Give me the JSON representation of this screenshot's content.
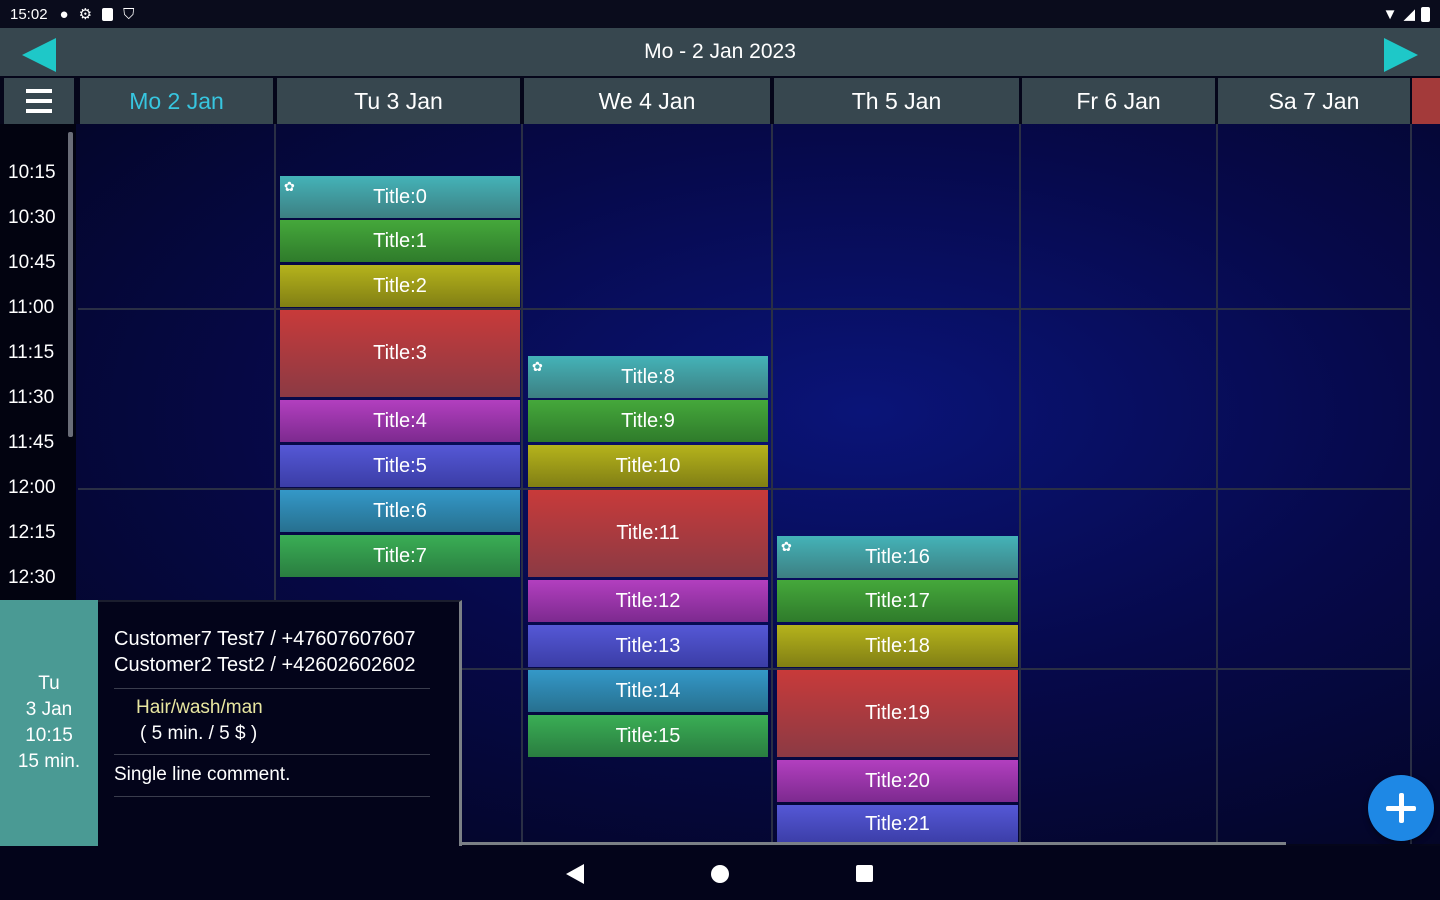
{
  "status_bar": {
    "time": "15:02"
  },
  "nav": {
    "title": "Mo - 2 Jan 2023"
  },
  "days": [
    {
      "label": "Mo   2 Jan",
      "today": true
    },
    {
      "label": "Tu   3 Jan"
    },
    {
      "label": "We   4 Jan"
    },
    {
      "label": "Th   5 Jan"
    },
    {
      "label": "Fr   6 Jan"
    },
    {
      "label": "Sa   7 Jan"
    }
  ],
  "times": [
    "10:15",
    "10:30",
    "10:45",
    "11:00",
    "11:15",
    "11:30",
    "11:45",
    "12:00",
    "12:15",
    "12:30"
  ],
  "events": {
    "e0": "Title:0",
    "e1": "Title:1",
    "e2": "Title:2",
    "e3": "Title:3",
    "e4": "Title:4",
    "e5": "Title:5",
    "e6": "Title:6",
    "e7": "Title:7",
    "e8": "Title:8",
    "e9": "Title:9",
    "e10": "Title:10",
    "e11": "Title:11",
    "e12": "Title:12",
    "e13": "Title:13",
    "e14": "Title:14",
    "e15": "Title:15",
    "e16": "Title:16",
    "e17": "Title:17",
    "e18": "Title:18",
    "e19": "Title:19",
    "e20": "Title:20",
    "e21": "Title:21"
  },
  "event_colors": {
    "teal": "#3d8f93",
    "green": "#3b9a34",
    "olive": "#a6a51b",
    "red": "#a9393f",
    "purple": "#9a33a6",
    "blue": "#4a4bc4",
    "steel": "#2d88b4",
    "green2": "#35a04e"
  },
  "detail": {
    "day": "Tu",
    "date": "3 Jan",
    "time": "10:15",
    "duration": "15 min.",
    "customer1": "Customer7 Test7 / +47607607607",
    "customer2": "Customer2 Test2 / +42602602602",
    "service": "Hair/wash/man",
    "service_detail": "(  5 min. / 5 $ )",
    "comment": "Single line comment."
  },
  "fab_icon": "plus-icon"
}
